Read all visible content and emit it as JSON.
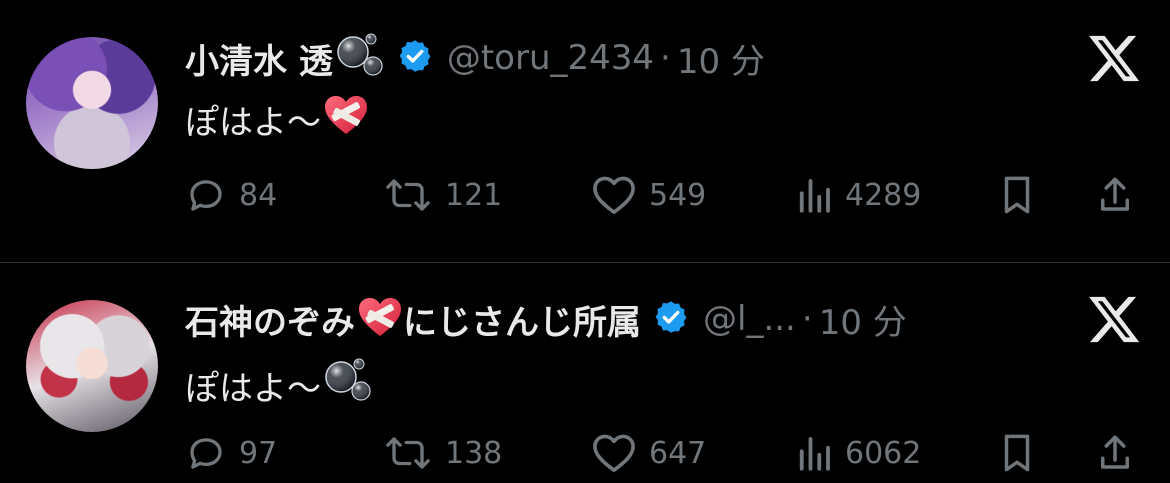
{
  "brand_icon": "x-logo-icon",
  "colors": {
    "background": "#000000",
    "text": "#e7e9ea",
    "muted": "#71767b",
    "verified": "#1d9bf0"
  },
  "tweets": [
    {
      "name": "小清水 透",
      "name_emoji": "bubbles-emoji",
      "verified": true,
      "handle": "@toru_2434",
      "separator": "·",
      "time": "10 分",
      "text": "ぽはよ〜",
      "text_emoji": "mending-heart-emoji",
      "replies": "84",
      "reposts": "121",
      "likes": "549",
      "views": "4289"
    },
    {
      "name": "石神のぞみ",
      "name_emoji": "mending-heart-emoji",
      "name_suffix": "にじさんじ所属",
      "verified": true,
      "handle": "@l_...",
      "separator": "·",
      "time": "10 分",
      "text": "ぽはよ〜",
      "text_emoji": "bubbles-emoji",
      "replies": "97",
      "reposts": "138",
      "likes": "647",
      "views": "6062"
    }
  ]
}
